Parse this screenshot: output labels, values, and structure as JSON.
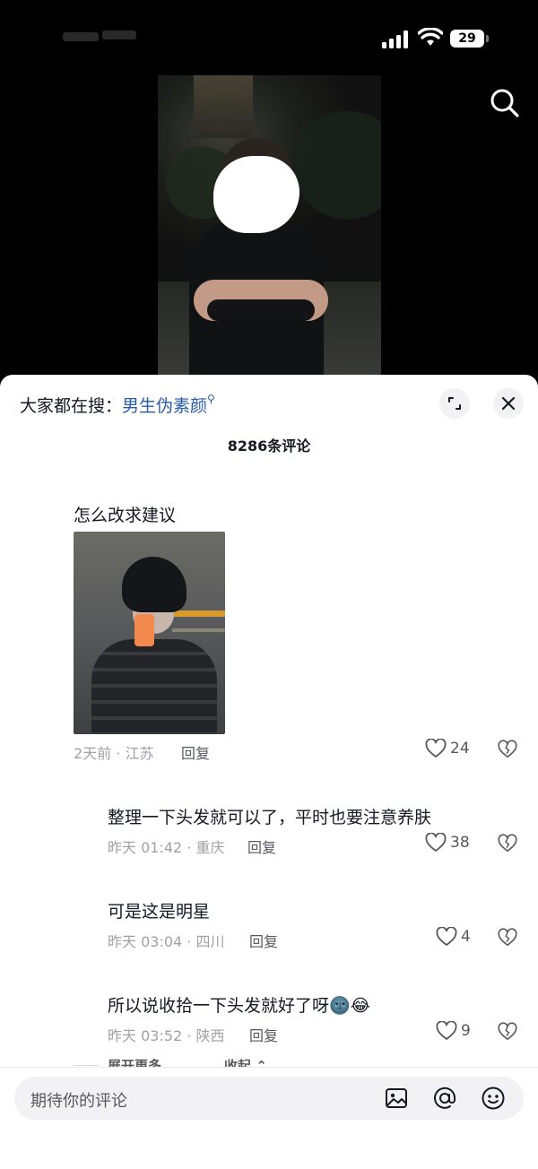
{
  "status_bar": {
    "battery": "29"
  },
  "sheet": {
    "trending_prefix": "大家都在搜：",
    "trending_keyword": "男生伪素颜",
    "comment_count": "8286条评论"
  },
  "comments": [
    {
      "text": "怎么改求建议",
      "meta": "2天前 · 江苏",
      "reply": "回复",
      "likes": "24",
      "has_image": true
    },
    {
      "text": "整理一下头发就可以了，平时也要注意养肤",
      "meta": "昨天 01:42 · 重庆",
      "reply": "回复",
      "likes": "38"
    },
    {
      "text": "可是这是明星",
      "meta": "昨天 03:04 · 四川",
      "reply": "回复",
      "likes": "4"
    },
    {
      "text": "所以说收拾一下头发就好了呀",
      "emojis": [
        "🌚",
        "😂"
      ],
      "meta": "昨天 03:52 · 陕西",
      "reply": "回复",
      "likes": "9"
    }
  ],
  "replies_controls": {
    "expand_more": "展开更多",
    "collapse": "收起"
  },
  "input": {
    "placeholder": "期待你的评论"
  },
  "icons": [
    "search-icon",
    "expand-icon",
    "close-icon",
    "heart-icon",
    "broken-heart-icon",
    "image-icon",
    "at-icon",
    "emoji-icon"
  ],
  "colors": {
    "keyword": "#2a5caa",
    "meta": "#a0a1a7",
    "sheet_bg": "#ffffff",
    "video_bg": "#000000"
  }
}
